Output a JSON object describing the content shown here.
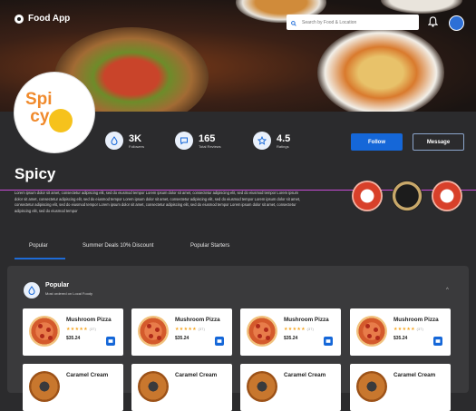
{
  "header": {
    "app_title": "Food App",
    "search_placeholder": "Search by Food & Location"
  },
  "brand": {
    "logo_text_1": "Spi",
    "logo_text_2": "cy"
  },
  "stats": [
    {
      "value": "3K",
      "label": "Followers"
    },
    {
      "value": "165",
      "label": "Total Reviews"
    },
    {
      "value": "4.5",
      "label": "Ratings"
    }
  ],
  "actions": {
    "follow": "Follow",
    "message": "Message"
  },
  "restaurant": {
    "name": "Spicy",
    "description": "Lorem ipsum dolor sit amet, consectetur adipiscing elit, sed do eiusmod tempor Lorem ipsum dolor sit amet, consectetur adipiscing elit, sed do eiusmod tempor Lorem ipsum dolor sit amet, consectetur adipiscing elit, sed do eiusmod tempor Lorem ipsum dolor sit amet, consectetur adipiscing elit, sed do eiusmod tempor Lorem ipsum dolor sit amet, consectetur adipiscing elit, sed do eiusmod tempor Lorem ipsum dolor sit amet, consectetur adipiscing elit, sed do eiusmod tempor Lorem ipsum dolor sit amet, consectetur adipiscing elit, sed do eiusmod tempor"
  },
  "tabs": [
    "Popular",
    "Summer Deals 10% Discount",
    "Popular Starters"
  ],
  "section": {
    "title": "Popular",
    "subtitle": "Most ordered on Local Foody"
  },
  "cards": [
    {
      "title": "Mushroom Pizza",
      "reviews": "(37)",
      "price": "$35.24"
    },
    {
      "title": "Mushroom Pizza",
      "reviews": "(37)",
      "price": "$35.24"
    },
    {
      "title": "Mushroom Pizza",
      "reviews": "(37)",
      "price": "$35.24"
    },
    {
      "title": "Mushroom Pizza",
      "reviews": "(37)",
      "price": "$35.24"
    },
    {
      "title": "Caramel Cream"
    },
    {
      "title": "Caramel Cream"
    },
    {
      "title": "Caramel Cream"
    },
    {
      "title": "Caramel Cream"
    }
  ],
  "colors": {
    "accent": "#1567d8",
    "brand_orange": "#f08a2c",
    "brand_yellow": "#f6c21c",
    "background": "#2b2b2d"
  }
}
